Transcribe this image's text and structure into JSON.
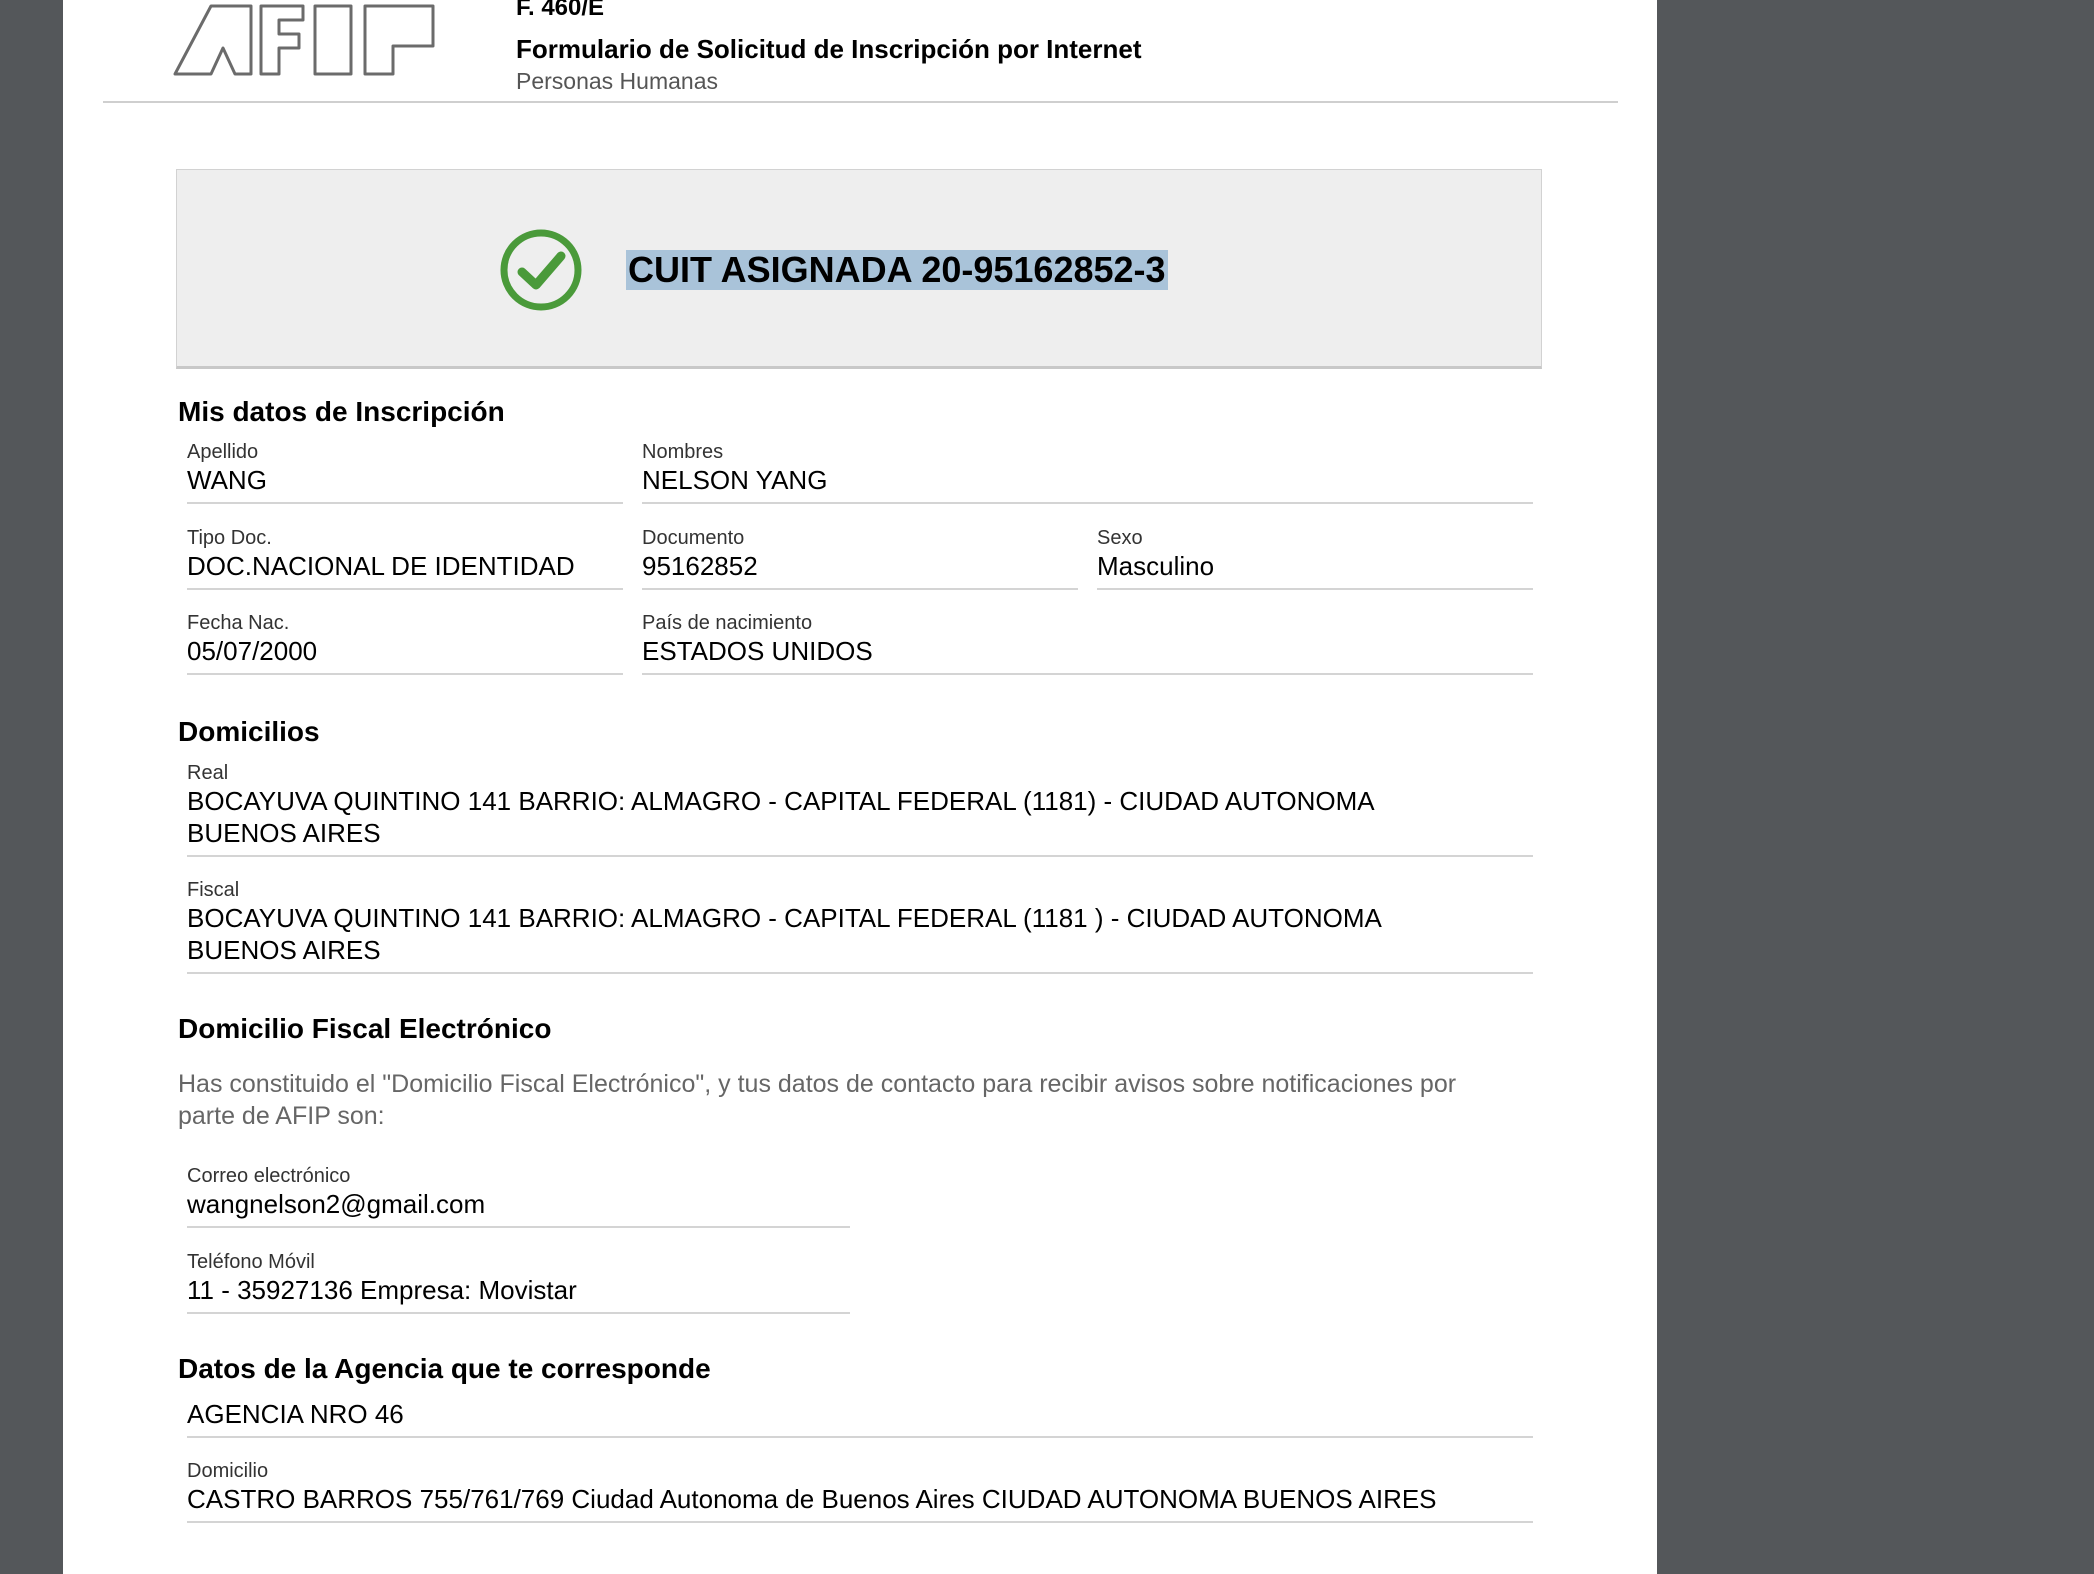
{
  "header": {
    "form_code": "F. 460/E",
    "form_title": "Formulario de Solicitud de Inscripción por Internet",
    "form_subtitle": "Personas Humanas",
    "logo_text": "AFIP"
  },
  "cuit": {
    "label": "CUIT ASIGNADA 20-95162852-3",
    "icon": "check-circle-icon",
    "icon_color": "#4a9a3a",
    "highlight_color": "#a9c3d9"
  },
  "inscripcion": {
    "title": "Mis datos de Inscripción",
    "apellido": {
      "label": "Apellido",
      "value": "WANG"
    },
    "nombres": {
      "label": "Nombres",
      "value": "NELSON YANG"
    },
    "tipo_doc": {
      "label": "Tipo Doc.",
      "value": "DOC.NACIONAL DE IDENTIDAD"
    },
    "documento": {
      "label": "Documento",
      "value": "95162852"
    },
    "sexo": {
      "label": "Sexo",
      "value": "Masculino"
    },
    "fecha_nac": {
      "label": "Fecha Nac.",
      "value": "05/07/2000"
    },
    "pais_nac": {
      "label": "País de nacimiento",
      "value": "ESTADOS UNIDOS"
    }
  },
  "domicilios": {
    "title": "Domicilios",
    "real": {
      "label": "Real",
      "line1": "BOCAYUVA QUINTINO 141 BARRIO: ALMAGRO - CAPITAL FEDERAL (1181) - CIUDAD AUTONOMA",
      "line2": "BUENOS AIRES"
    },
    "fiscal": {
      "label": "Fiscal",
      "line1": "BOCAYUVA QUINTINO 141 BARRIO: ALMAGRO - CAPITAL FEDERAL (1181 ) - CIUDAD AUTONOMA",
      "line2": "BUENOS AIRES"
    }
  },
  "domicilio_electronico": {
    "title": "Domicilio Fiscal Electrónico",
    "paragraph_line1": "Has constituido el \"Domicilio Fiscal Electrónico\", y tus datos de contacto para recibir avisos sobre notificaciones por",
    "paragraph_line2": "parte de AFIP son:",
    "correo": {
      "label": "Correo electrónico",
      "value": "wangnelson2@gmail.com"
    },
    "telefono": {
      "label": "Teléfono Móvil",
      "value": "11 - 35927136 Empresa: Movistar"
    }
  },
  "agencia": {
    "title": "Datos de la Agencia que te corresponde",
    "nombre": "AGENCIA NRO 46",
    "domicilio": {
      "label": "Domicilio",
      "value": "CASTRO BARROS 755/761/769 Ciudad Autonoma de Buenos Aires CIUDAD AUTONOMA BUENOS AIRES"
    }
  }
}
